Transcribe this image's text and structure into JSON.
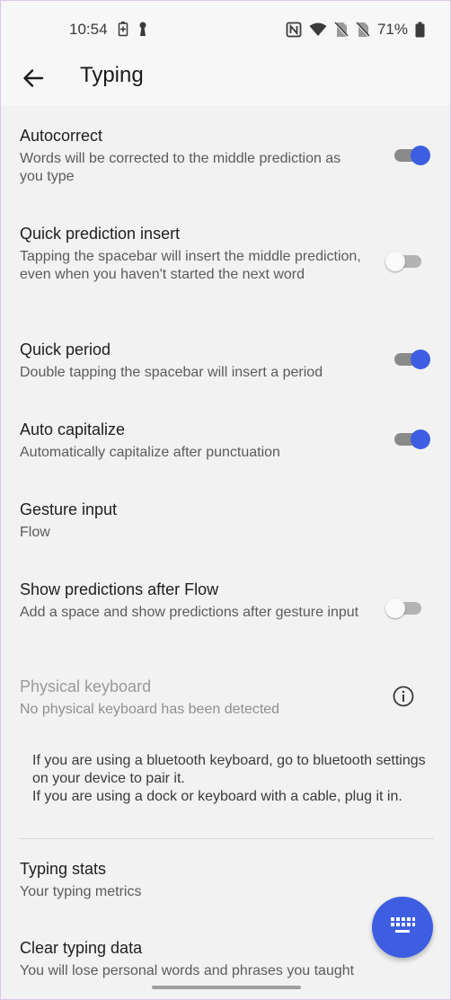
{
  "status_bar": {
    "time": "10:54",
    "battery": "71%",
    "left_icons": [
      "battery-saver-icon",
      "keyhole-icon"
    ],
    "right_icons": [
      "nfc-icon",
      "wifi-icon",
      "no-sim-icon",
      "no-sim-icon",
      "battery-icon"
    ]
  },
  "app_bar": {
    "title": "Typing",
    "back_icon": "arrow-back-icon"
  },
  "settings": [
    {
      "title": "Autocorrect",
      "subtitle": "Words will be corrected to the middle prediction as you type",
      "toggle": "on"
    },
    {
      "title": "Quick prediction insert",
      "subtitle": "Tapping the spacebar will insert the middle prediction, even when you haven't started the next word",
      "toggle": "off"
    },
    {
      "title": "Quick period",
      "subtitle": "Double tapping the spacebar will insert a period",
      "toggle": "on"
    },
    {
      "title": "Auto capitalize",
      "subtitle": "Automatically capitalize after punctuation",
      "toggle": "on"
    },
    {
      "title": "Gesture input",
      "subtitle": "Flow"
    },
    {
      "title": "Show predictions after Flow",
      "subtitle": "Add a space and show predictions after gesture input",
      "toggle": "off"
    },
    {
      "title": "Physical keyboard",
      "subtitle": "No physical keyboard has been detected",
      "icon": "info-icon",
      "disabled": true
    },
    {
      "title": "Typing stats",
      "subtitle": "Your typing metrics"
    },
    {
      "title": "Clear typing data",
      "subtitle": "You will lose personal words and phrases you taught"
    }
  ],
  "note": {
    "line1": "If you are using a bluetooth keyboard, go to bluetooth settings on your device to pair it.",
    "line2": "If you are using a dock or keyboard with a cable, plug it in."
  },
  "fab": {
    "icon": "keyboard-icon"
  },
  "colors": {
    "accent": "#3d5ee1",
    "background": "#f2f2f2"
  }
}
